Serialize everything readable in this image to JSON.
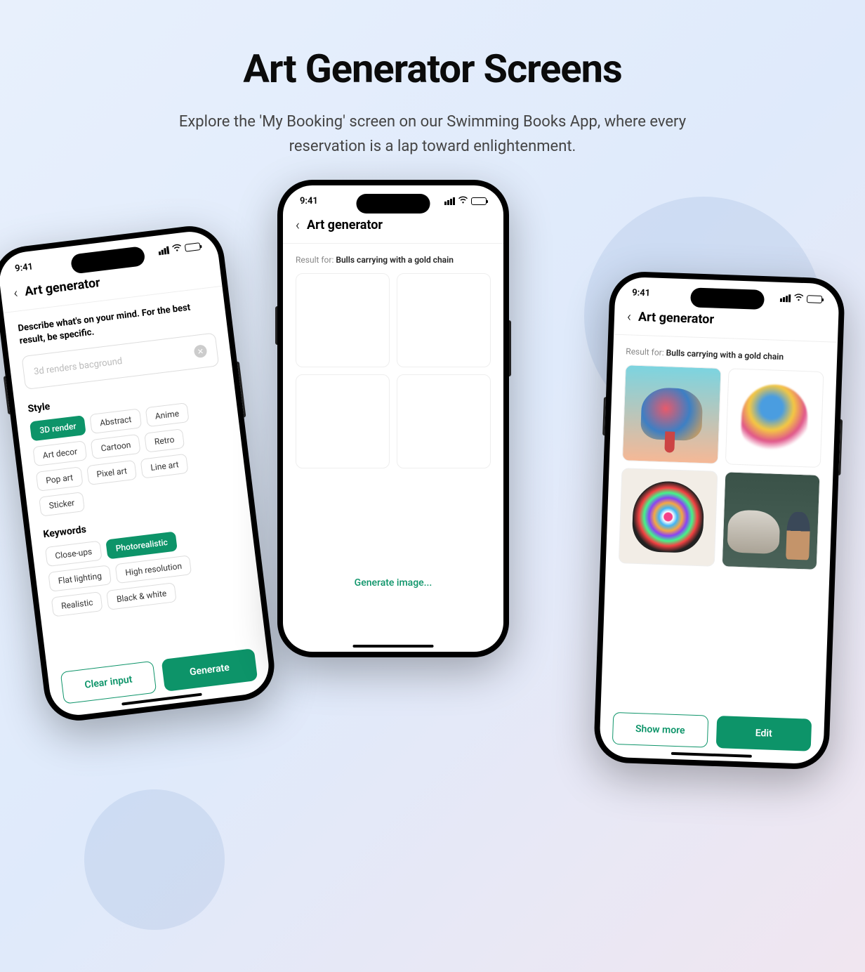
{
  "header": {
    "title": "Art Generator Screens",
    "subtitle": "Explore the 'My Booking' screen on our Swimming Books App, where every reservation is a lap toward enlightenment."
  },
  "statusbar": {
    "time": "9:41"
  },
  "screen1": {
    "title": "Art generator",
    "prompt_label": "Describe what's on your mind. For the best result, be specific.",
    "placeholder": "3d renders bacground",
    "style_label": "Style",
    "styles": [
      "3D render",
      "Abstract",
      "Anime",
      "Art decor",
      "Cartoon",
      "Retro",
      "Pop art",
      "Pixel art",
      "Line art",
      "Sticker"
    ],
    "style_active": "3D render",
    "keywords_label": "Keywords",
    "keywords": [
      "Close-ups",
      "Photorealistic",
      "Flat lighting",
      "High resolution",
      "Realistic",
      "Black & white"
    ],
    "keyword_active": "Photorealistic",
    "clear_btn": "Clear input",
    "generate_btn": "Generate"
  },
  "screen2": {
    "title": "Art generator",
    "result_prefix": "Result for: ",
    "result_query": "Bulls carrying with a gold chain",
    "loading": "Generate image..."
  },
  "screen3": {
    "title": "Art generator",
    "result_prefix": "Result for: ",
    "result_query": "Bulls carrying with a gold chain",
    "show_more_btn": "Show more",
    "edit_btn": "Edit"
  }
}
